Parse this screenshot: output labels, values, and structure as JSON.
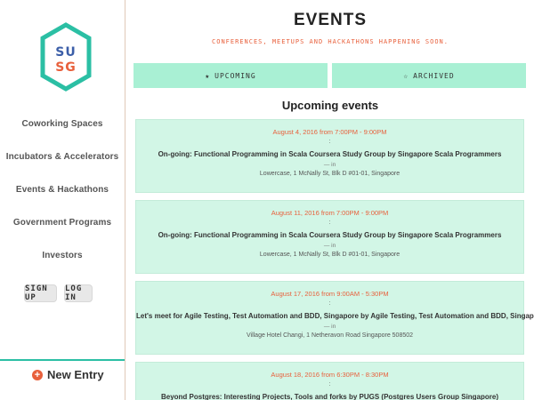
{
  "logo": {
    "line1": "SU",
    "line2": "SG",
    "line1_color": "#3b5ea8",
    "line2_color": "#e8603c",
    "hex_color": "#2bbfa4"
  },
  "sidebar": {
    "items": [
      {
        "label": "Coworking Spaces"
      },
      {
        "label": "Incubators & Accelerators"
      },
      {
        "label": "Events & Hackathons"
      },
      {
        "label": "Government Programs"
      },
      {
        "label": "Investors"
      }
    ],
    "signup_label": "SIGN UP",
    "login_label": "LOG IN",
    "new_entry_label": "New Entry",
    "new_entry_icon": "plus-circle-icon"
  },
  "header": {
    "title": "EVENTS",
    "subtitle": "CONFERENCES, MEETUPS AND HACKATHONS HAPPENING SOON."
  },
  "tabs": [
    {
      "icon": "★",
      "label": "UPCOMING"
    },
    {
      "icon": "☆",
      "label": "ARCHIVED"
    }
  ],
  "section_heading": "Upcoming events",
  "events": [
    {
      "date": "August 4, 2016 from 7:00PM - 9:00PM",
      "colon": ":",
      "title": "On-going: Functional Programming in Scala Coursera Study Group by Singapore Scala Programmers",
      "in": "— in",
      "venue": "Lowercase, 1 McNally St, Blk D #01-01, Singapore"
    },
    {
      "date": "August 11, 2016 from 7:00PM - 9:00PM",
      "colon": ":",
      "title": "On-going: Functional Programming in Scala Coursera Study Group by Singapore Scala Programmers",
      "in": "— in",
      "venue": "Lowercase, 1 McNally St, Blk D #01-01, Singapore"
    },
    {
      "date": "August 17, 2016 from 9:00AM - 5:30PM",
      "colon": ":",
      "title": "Let's meet for Agile Testing, Test Automation and BDD, Singapore by Agile Testing, Test Automation and BDD, Singapore",
      "in": "— in",
      "venue": "Village Hotel Changi, 1 Netheravon Road Singapore 508502"
    },
    {
      "date": "August 18, 2016 from 6:30PM - 8:30PM",
      "colon": ":",
      "title": "Beyond Postgres: Interesting Projects, Tools and forks by PUGS (Postgres Users Group Singapore)",
      "in": "",
      "venue": ""
    }
  ]
}
